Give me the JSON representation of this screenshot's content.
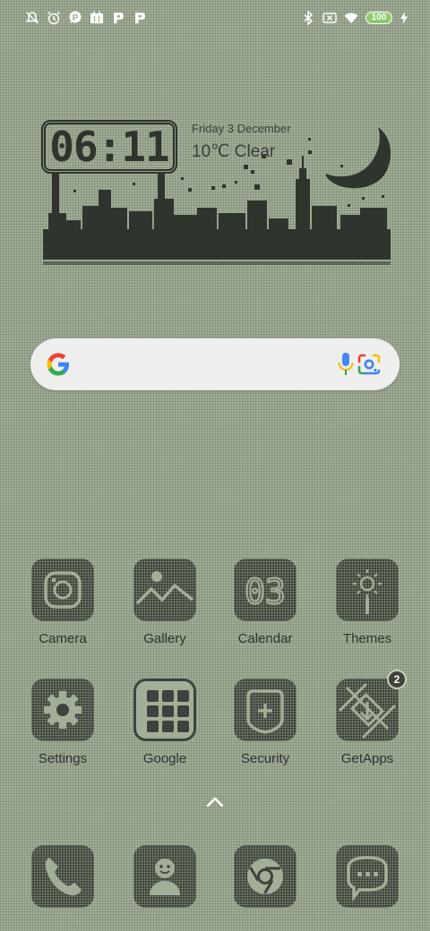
{
  "status_bar": {
    "left_icons": [
      "notifications-off-icon",
      "alarm-icon",
      "parking-app-icon",
      "calendar-grid-icon",
      "parking-app-icon",
      "parking-app-icon"
    ],
    "right_icons": [
      "bluetooth-icon",
      "no-sim-icon",
      "wifi-icon"
    ],
    "battery_level": "100",
    "charging": true
  },
  "widget": {
    "time": "06:11",
    "date": "Friday 3 December",
    "weather": "10℃  Clear"
  },
  "search_bar": {
    "icons": [
      "google-logo-icon",
      "microphone-icon",
      "google-lens-icon"
    ]
  },
  "apps": [
    {
      "label": "Camera",
      "icon": "camera-icon"
    },
    {
      "label": "Gallery",
      "icon": "gallery-icon"
    },
    {
      "label": "Calendar",
      "icon": "calendar-icon",
      "icon_text": "03"
    },
    {
      "label": "Themes",
      "icon": "themes-icon"
    },
    {
      "label": "Settings",
      "icon": "settings-gear-icon"
    },
    {
      "label": "Google",
      "icon": "google-folder-icon"
    },
    {
      "label": "Security",
      "icon": "security-shield-icon"
    },
    {
      "label": "GetApps",
      "icon": "getapps-icon",
      "badge": "2"
    }
  ],
  "dock": [
    {
      "icon": "phone-icon"
    },
    {
      "icon": "contacts-icon"
    },
    {
      "icon": "chrome-icon"
    },
    {
      "icon": "messages-icon"
    }
  ],
  "colors": {
    "background": "#a3ae98",
    "tile": "#3e433a",
    "text": "#2f342c",
    "battery": "#8ecb6e"
  }
}
